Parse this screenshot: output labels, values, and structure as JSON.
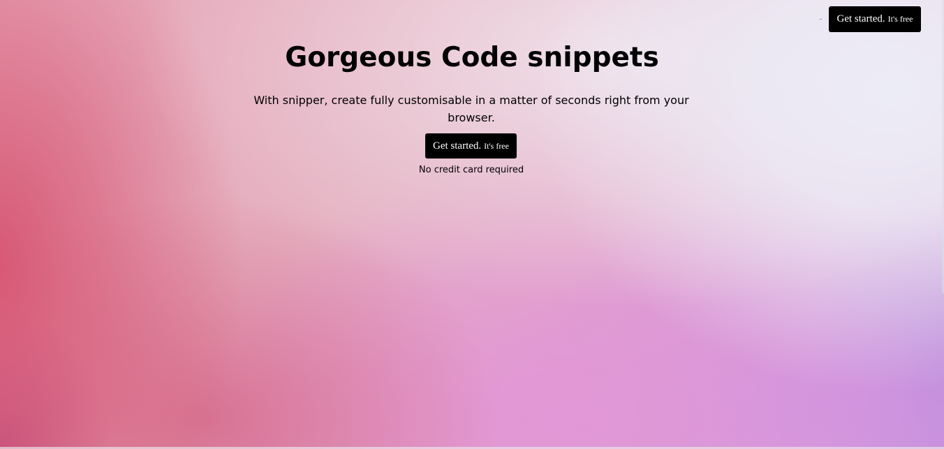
{
  "header": {
    "cta_main": "Get started.",
    "cta_sub": "It's free"
  },
  "hero": {
    "title": "Gorgeous Code snippets",
    "subtitle": "With snipper, create fully customisable in a matter of seconds right from your browser.",
    "cta_main": "Get started.",
    "cta_sub": "It's free",
    "note": "No credit card required"
  },
  "colors": {
    "button_bg": "#000000",
    "button_text": "#ffffff",
    "text": "#000000",
    "gradient_pink": "#d65270",
    "gradient_lavender": "#ecebf6",
    "gradient_purple": "#ce94e2"
  }
}
